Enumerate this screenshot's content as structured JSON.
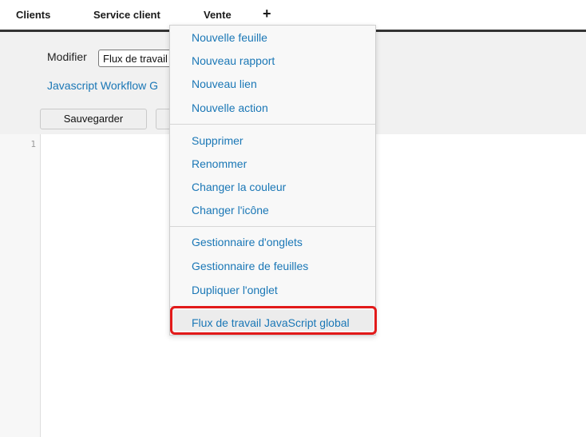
{
  "nav": {
    "tabs": [
      "Clients",
      "Service client",
      "Vente"
    ],
    "add_label": "+"
  },
  "toolbar": {
    "modifier_label": "Modifier",
    "modifier_value": "Flux de travail JavaScript global",
    "workflow_link": "Javascript Workflow G",
    "save_label": "Sauvegarder"
  },
  "editor": {
    "line_numbers": [
      "1"
    ]
  },
  "menu": {
    "groups": [
      [
        "Nouvelle feuille",
        "Nouveau rapport",
        "Nouveau lien",
        "Nouvelle action"
      ],
      [
        "Supprimer",
        "Renommer",
        "Changer la couleur",
        "Changer l'icône"
      ],
      [
        "Gestionnaire d'onglets",
        "Gestionnaire de feuilles",
        "Dupliquer l'onglet"
      ],
      [
        "Flux de travail JavaScript global"
      ]
    ]
  },
  "colors": {
    "link": "#1a77b6",
    "highlight_border": "#e21a1a"
  }
}
